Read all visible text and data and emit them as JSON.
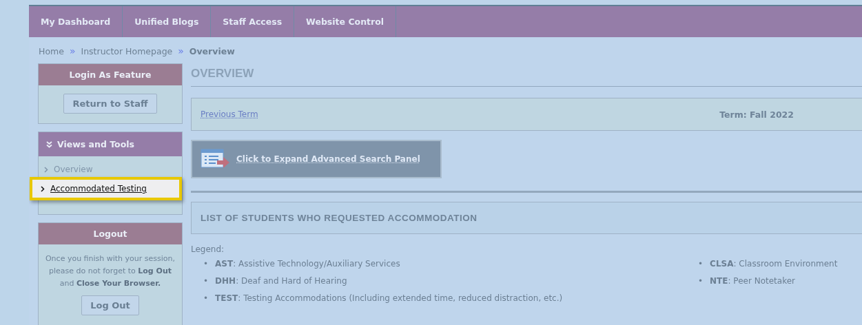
{
  "nav": [
    {
      "label": "My Dashboard"
    },
    {
      "label": "Unified Blogs"
    },
    {
      "label": "Staff Access"
    },
    {
      "label": "Website Control"
    }
  ],
  "breadcrumb": [
    {
      "label": "Home",
      "current": false
    },
    {
      "label": "Instructor Homepage",
      "current": false
    },
    {
      "label": "Overview",
      "current": true
    }
  ],
  "breadcrumb_separator": "»",
  "login_as": {
    "title": "Login As Feature",
    "button": "Return to Staff"
  },
  "views_and_tools": {
    "title": "Views and Tools",
    "items": [
      {
        "label": "Overview",
        "highlighted": false
      },
      {
        "label": "Accommodated Testing",
        "highlighted": true
      }
    ]
  },
  "logout": {
    "title": "Logout",
    "message": "Once you finish with your session, please do not forget to **Log Out** and **Close Your Browser.**",
    "button": "Log Out"
  },
  "page_title": "OVERVIEW",
  "term_bar": {
    "link": "Previous Term",
    "term": "Term: Fall 2022"
  },
  "search_panel_button": "Click to Expand Advanced Search Panel",
  "list_title": "LIST OF STUDENTS WHO REQUESTED ACCOMMODATION",
  "legend": {
    "label": "Legend:",
    "bullet": "•",
    "columns": [
      [
        {
          "code": "AST",
          "text": ": Assistive Technology/Auxiliary Services"
        },
        {
          "code": "DHH",
          "text": ": Deaf and Hard of Hearing"
        },
        {
          "code": "TEST",
          "text": ": Testing Accommodations (Including extended time, reduced distraction, etc.)"
        }
      ],
      [
        {
          "code": "CLSA",
          "text": ": Classroom Environment"
        },
        {
          "code": "NTE",
          "text": ": Peer Notetaker"
        }
      ]
    ]
  }
}
